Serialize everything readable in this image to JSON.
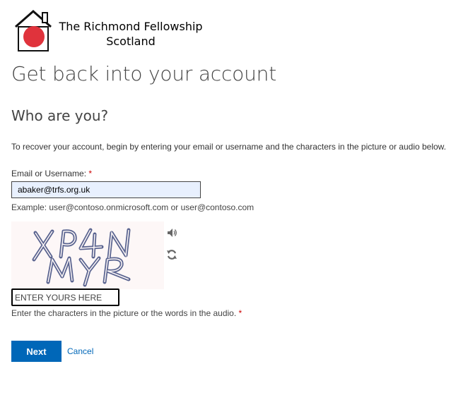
{
  "brand": {
    "org_name_line1": "The Richmond Fellowship",
    "org_name_line2": "Scotland",
    "logo_icon": "house-with-red-circle-logo",
    "logo_color": "#e0333c"
  },
  "page": {
    "title": "Get back into your account",
    "subtitle": "Who are you?",
    "intro": "To recover your account, begin by entering your email or username and the characters in the picture or audio below."
  },
  "email_field": {
    "label": "Email or Username:",
    "required_marker": "*",
    "value": "abaker@trfs.org.uk",
    "hint": "Example: user@contoso.onmicrosoft.com or user@contoso.com"
  },
  "captcha": {
    "image_text": "XP4N MYR",
    "audio_icon": "speaker-icon",
    "refresh_icon": "refresh-icon",
    "input_placeholder": "ENTER YOURS HERE",
    "hint": "Enter the characters in the picture or the words in the audio.",
    "required_marker": "*"
  },
  "actions": {
    "next_label": "Next",
    "cancel_label": "Cancel"
  },
  "colors": {
    "accent": "#0067b8",
    "required": "#cc0000",
    "autofill_bg": "#e8f0fe"
  }
}
